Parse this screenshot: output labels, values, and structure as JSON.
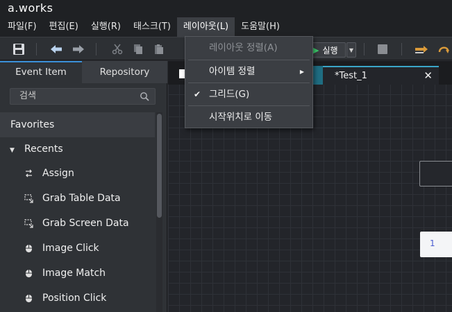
{
  "app": {
    "logo": "a.works"
  },
  "menubar": {
    "items": [
      {
        "label": "파일(F)"
      },
      {
        "label": "편집(E)"
      },
      {
        "label": "실행(R)"
      },
      {
        "label": "태스크(T)"
      },
      {
        "label": "레이아웃(L)"
      },
      {
        "label": "도움말(H)"
      }
    ],
    "active": "레이아웃(L)"
  },
  "toolbar": {
    "run_label": "실행",
    "icons": [
      "save-icon",
      "undo-arrow-icon",
      "redo-arrow-icon",
      "cut-icon",
      "copy-icon",
      "paste-icon",
      "stop-icon",
      "step-over-icon",
      "step-back-icon"
    ]
  },
  "layout_menu": {
    "items": [
      {
        "label": "레이아웃 정렬(A)",
        "disabled": true
      },
      {
        "label": "아이템 정렬",
        "submenu": true
      },
      {
        "label": "그리드(G)",
        "checked": true
      },
      {
        "label": "시작위치로 이동"
      }
    ]
  },
  "left_panel": {
    "tabs": [
      {
        "label": "Event Item",
        "active": true
      },
      {
        "label": "Repository",
        "active": false
      }
    ],
    "search": {
      "placeholder": "검색"
    },
    "favorites_label": "Favorites",
    "recents_label": "Recents",
    "recent_items": [
      {
        "label": "Assign",
        "icon": "assign-swap-icon"
      },
      {
        "label": "Grab Table Data",
        "icon": "grab-selection-icon"
      },
      {
        "label": "Grab Screen Data",
        "icon": "grab-selection-icon"
      },
      {
        "label": "Image Click",
        "icon": "mouse-icon"
      },
      {
        "label": "Image Match",
        "icon": "mouse-icon"
      },
      {
        "label": "Position Click",
        "icon": "mouse-icon"
      }
    ]
  },
  "document": {
    "tab_label": "*Test_1",
    "close_glyph": "✕",
    "node_label": "1"
  },
  "colors": {
    "accent_tab": "#3a8fd8",
    "doc_tab_accent": "#3aa6c9",
    "run_play": "#3ecf6e"
  }
}
